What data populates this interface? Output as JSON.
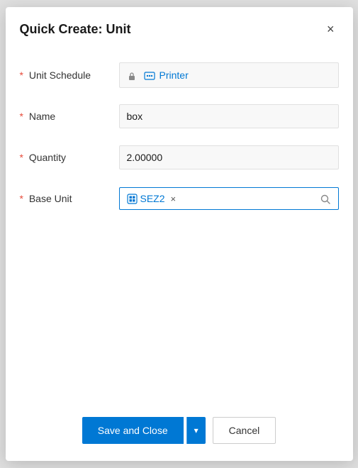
{
  "dialog": {
    "title": "Quick Create: Unit",
    "close_label": "×"
  },
  "form": {
    "unit_schedule": {
      "label": "Unit Schedule",
      "required": true,
      "locked": true,
      "value": "Printer",
      "icon": "schedule-icon"
    },
    "name": {
      "label": "Name",
      "required": true,
      "value": "box",
      "placeholder": ""
    },
    "quantity": {
      "label": "Quantity",
      "required": true,
      "value": "2.00000",
      "placeholder": ""
    },
    "base_unit": {
      "label": "Base Unit",
      "required": true,
      "tag_value": "SEZ2",
      "icon": "base-unit-icon"
    }
  },
  "footer": {
    "save_label": "Save and Close",
    "dropdown_arrow": "▾",
    "cancel_label": "Cancel"
  }
}
